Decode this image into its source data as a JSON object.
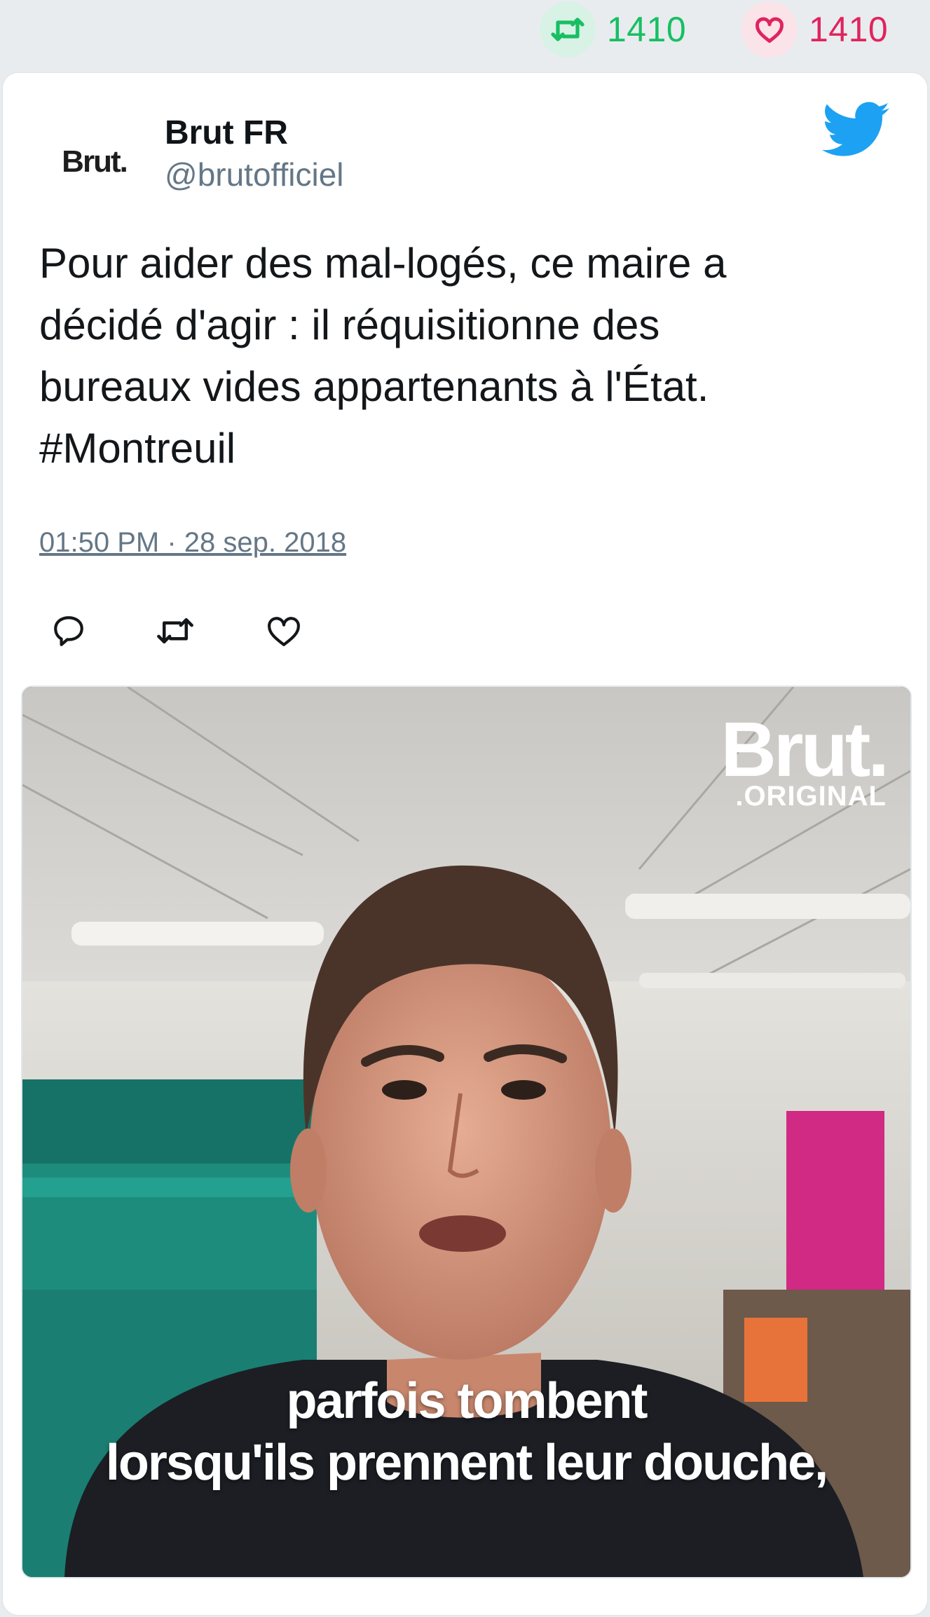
{
  "stats": {
    "retweets": "1410",
    "likes": "1410",
    "retweet_color": "#17bf63",
    "like_color": "#e0245e",
    "retweet_icon": "retweet-icon",
    "like_icon": "heart-icon"
  },
  "tweet": {
    "avatar_text": "Brut.",
    "display_name": "Brut FR",
    "handle": "@brutofficiel",
    "platform_icon": "twitter-bird-icon",
    "brand_color": "#1da1f2",
    "text_lines": [
      "Pour aider des mal-logés, ce maire a",
      "décidé d'agir : il réquisitionne des",
      "bureaux vides appartenants à l'État.",
      "#Montreuil"
    ],
    "timestamp": "01:50 PM · 28 sep. 2018",
    "actions": [
      {
        "icon": "reply-icon"
      },
      {
        "icon": "retweet-icon"
      },
      {
        "icon": "heart-icon"
      }
    ]
  },
  "media": {
    "logo": "Brut.",
    "logo_sub": ".ORIGINAL",
    "subtitle_lines": [
      "parfois tombent",
      "lorsqu'ils prennent leur douche,"
    ]
  }
}
